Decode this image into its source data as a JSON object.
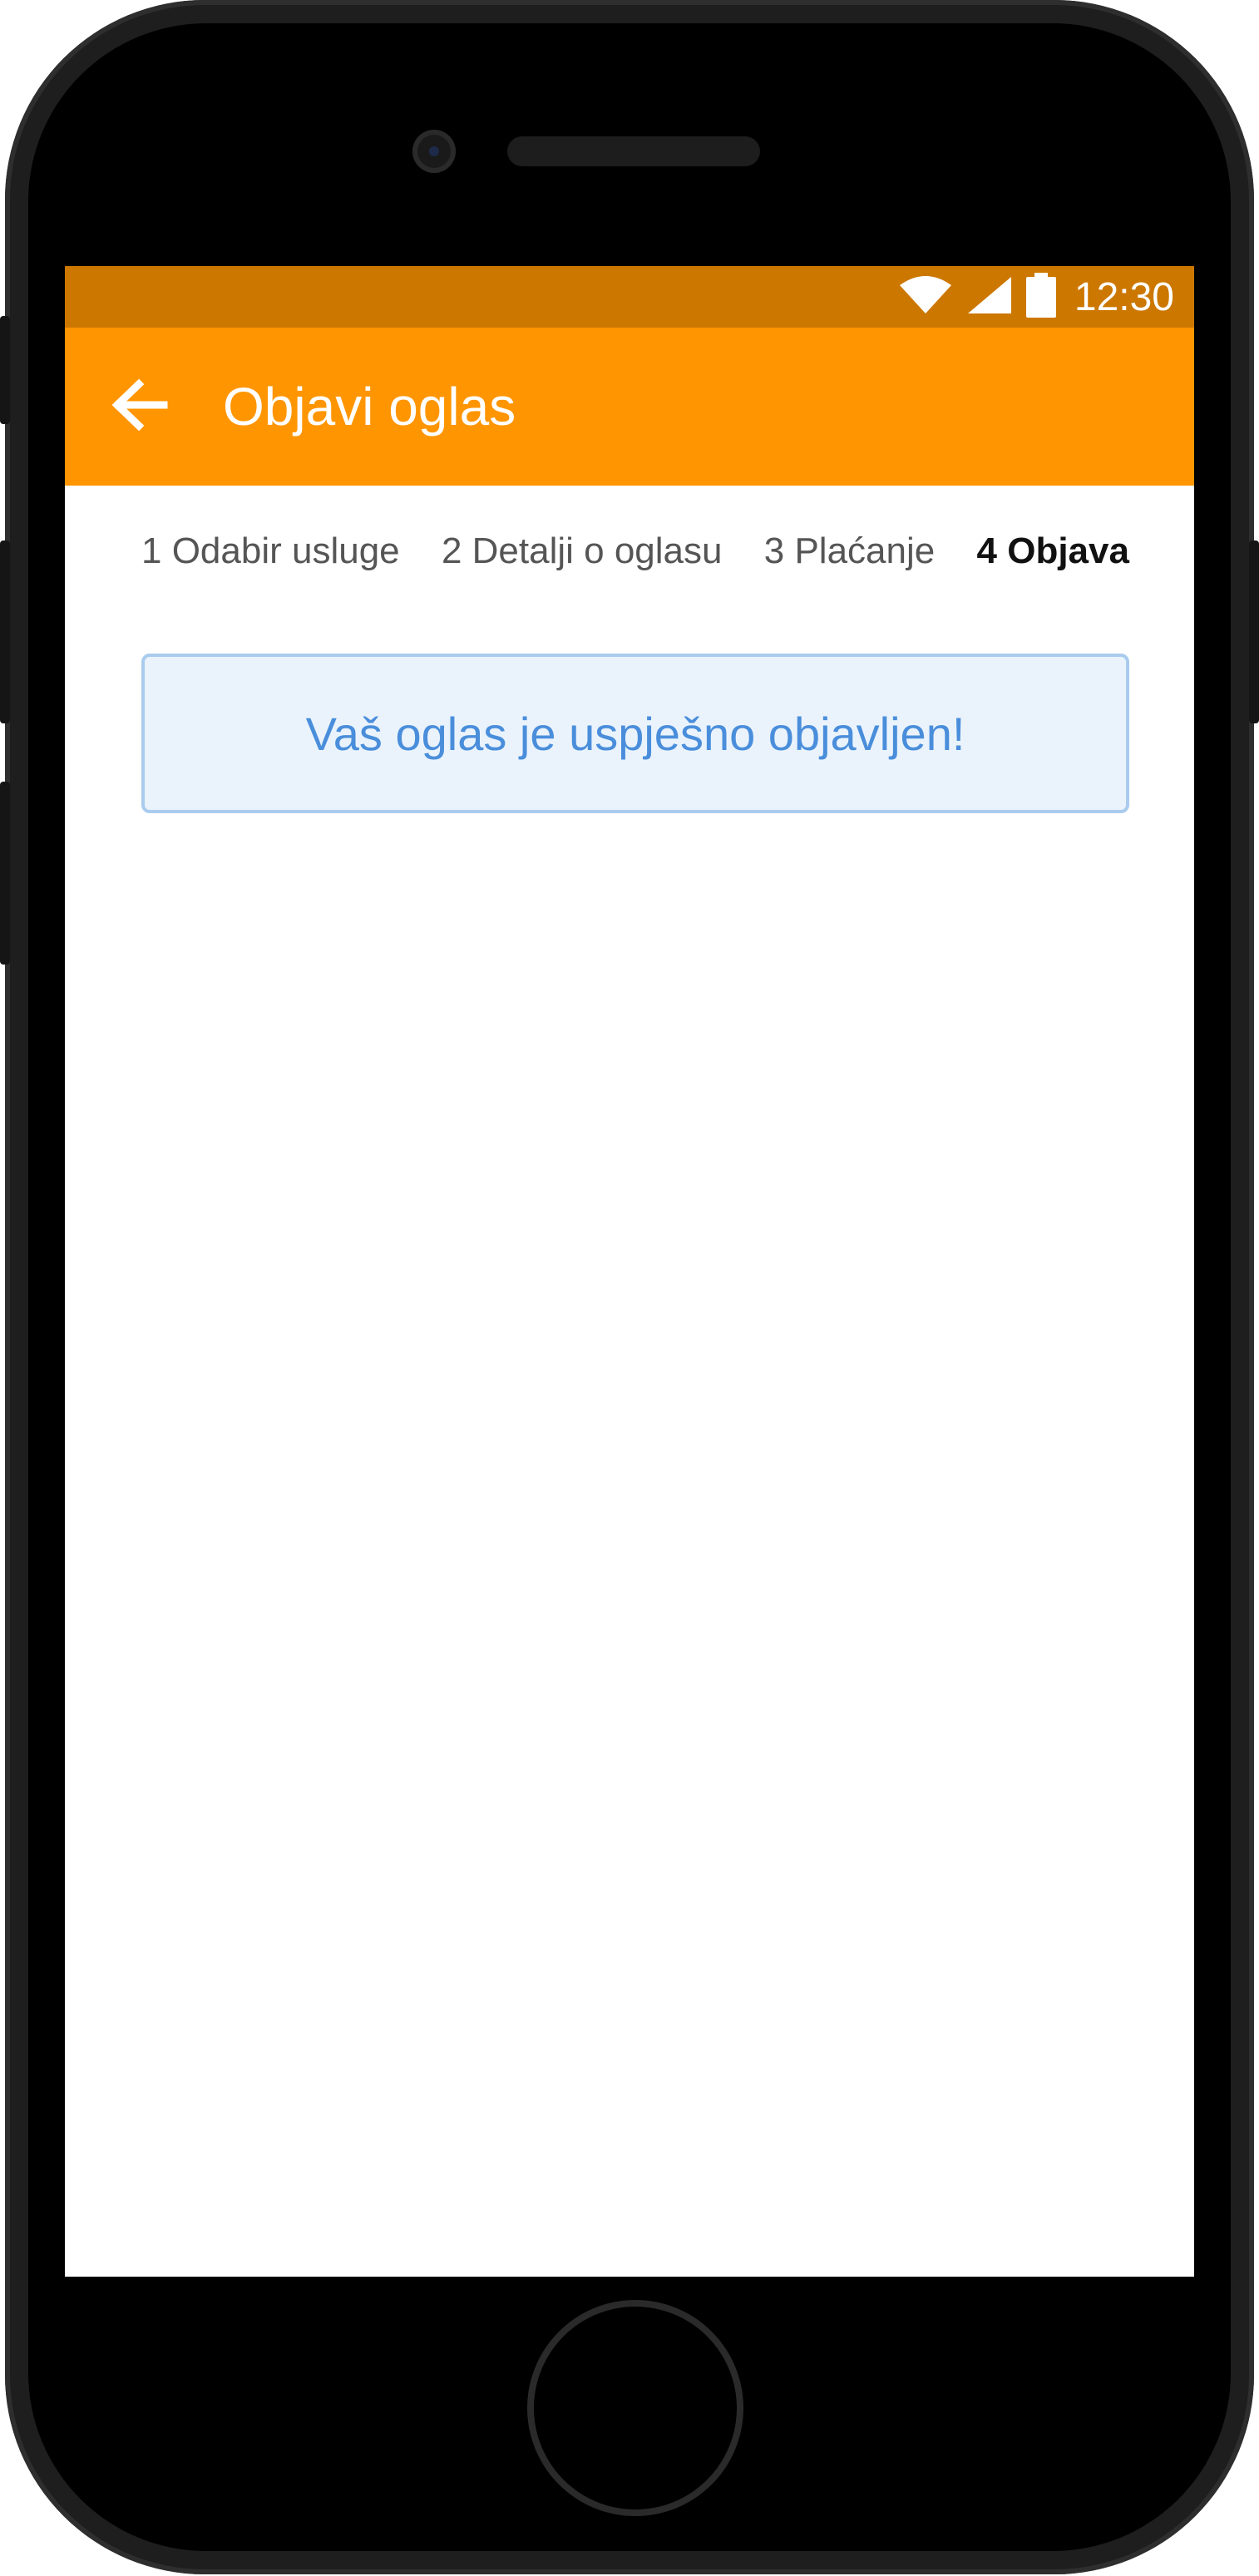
{
  "status_bar": {
    "time": "12:30",
    "icons": [
      "wifi-icon",
      "cellular-signal-icon",
      "battery-icon"
    ]
  },
  "app_bar": {
    "back_icon": "arrow-left-icon",
    "title": "Objavi oglas",
    "background_color": "#ff9500",
    "status_color": "#cc7700"
  },
  "steps": [
    {
      "label": "1 Odabir usluge",
      "active": false
    },
    {
      "label": "2 Detalji o oglasu",
      "active": false
    },
    {
      "label": "3 Plaćanje",
      "active": false
    },
    {
      "label": "4 Objava",
      "active": true
    }
  ],
  "message": {
    "text": "Vaš oglas je uspješno objavljen!",
    "text_color": "#4a8edb",
    "background_color": "#eaf3fc",
    "border_color": "#a9cbee"
  }
}
